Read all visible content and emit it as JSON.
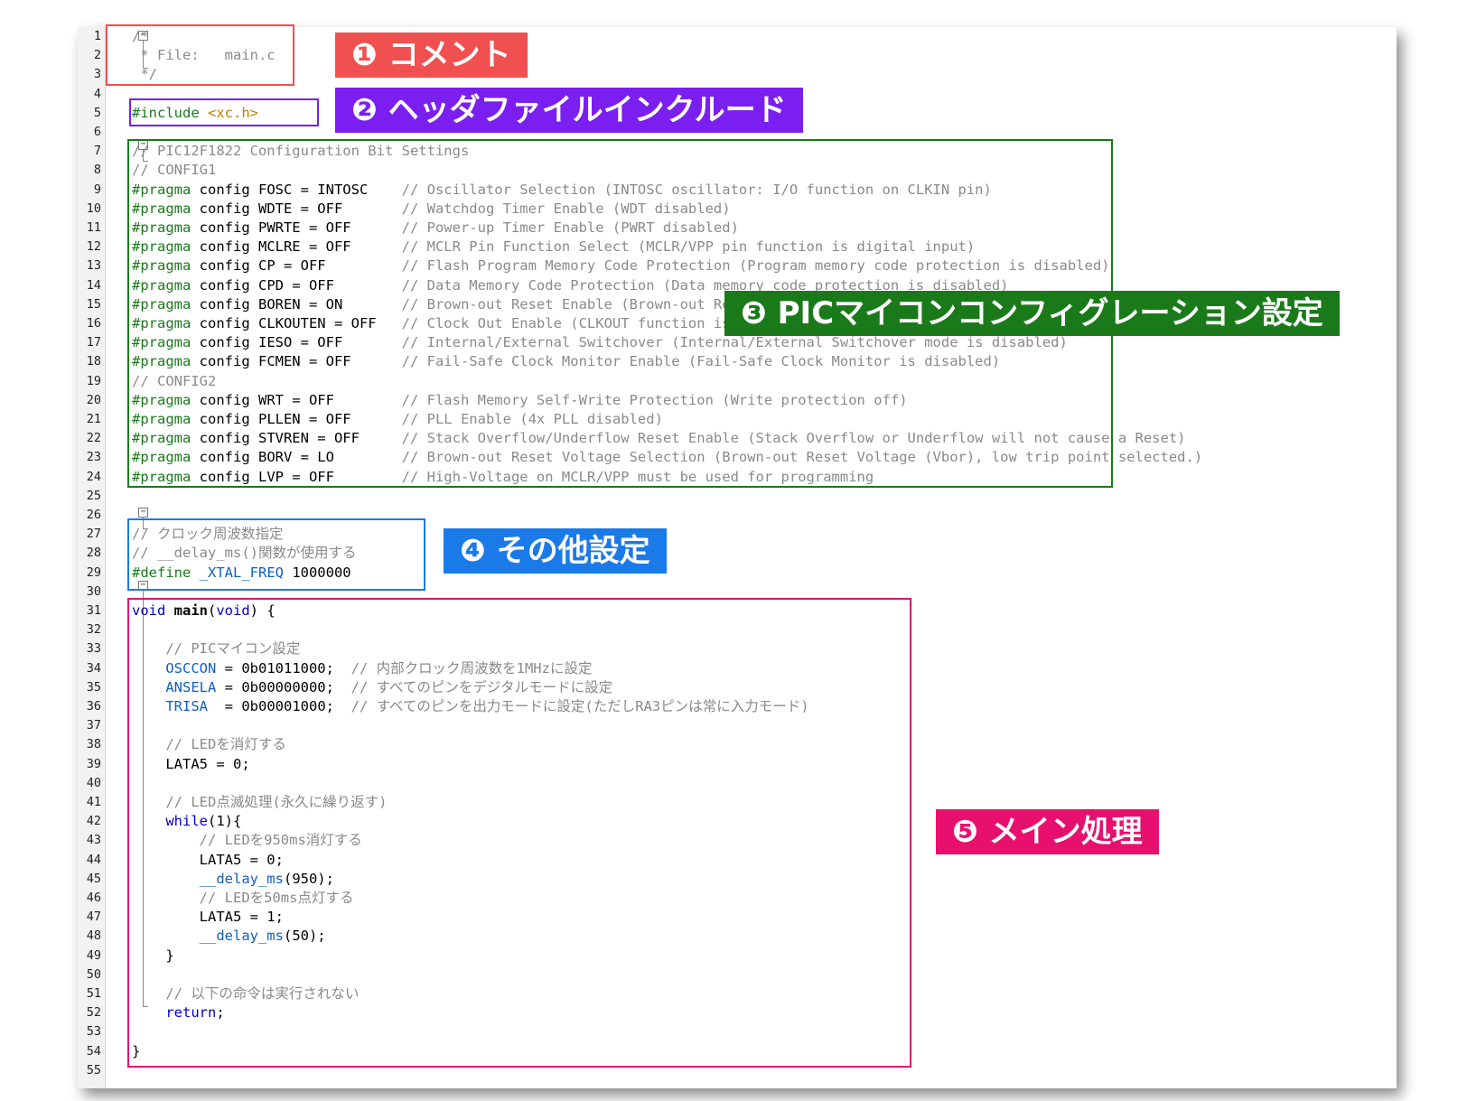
{
  "line_numbers": [
    "1",
    "2",
    "3",
    "4",
    "5",
    "6",
    "7",
    "8",
    "9",
    "10",
    "11",
    "12",
    "13",
    "14",
    "15",
    "16",
    "17",
    "18",
    "19",
    "20",
    "21",
    "22",
    "23",
    "24",
    "25",
    "26",
    "27",
    "28",
    "29",
    "30",
    "31",
    "32",
    "33",
    "34",
    "35",
    "36",
    "37",
    "38",
    "39",
    "40",
    "41",
    "42",
    "43",
    "44",
    "45",
    "46",
    "47",
    "48",
    "49",
    "50",
    "51",
    "52",
    "53",
    "54",
    "55"
  ],
  "code": {
    "l1": "/*",
    "l2": " * File:   main.c",
    "l3": " */",
    "l5_pp": "#include ",
    "l5_str": "<xc.h>",
    "l7": "// PIC12F1822 Configuration Bit Settings",
    "l8": "// CONFIG1",
    "pragma": "#pragma",
    "p9": " config FOSC = INTOSC    ",
    "c9": "// Oscillator Selection (INTOSC oscillator: I/O function on CLKIN pin)",
    "p10": " config WDTE = OFF       ",
    "c10": "// Watchdog Timer Enable (WDT disabled)",
    "p11": " config PWRTE = OFF      ",
    "c11": "// Power-up Timer Enable (PWRT disabled)",
    "p12": " config MCLRE = OFF      ",
    "c12": "// MCLR Pin Function Select (MCLR/VPP pin function is digital input)",
    "p13": " config CP = OFF         ",
    "c13": "// Flash Program Memory Code Protection (Program memory code protection is disabled)",
    "p14": " config CPD = OFF        ",
    "c14": "// Data Memory Code Protection (Data memory code protection is disabled)",
    "p15": " config BOREN = ON       ",
    "c15": "// Brown-out Reset Enable (Brown-out Reset enabled)",
    "p16": " config CLKOUTEN = OFF   ",
    "c16": "// Clock Out Enable (CLKOUT function is disabled)",
    "p17": " config IESO = OFF       ",
    "c17": "// Internal/External Switchover (Internal/External Switchover mode is disabled)",
    "p18": " config FCMEN = OFF      ",
    "c18": "// Fail-Safe Clock Monitor Enable (Fail-Safe Clock Monitor is disabled)",
    "l19": "// CONFIG2",
    "p20": " config WRT = OFF        ",
    "c20": "// Flash Memory Self-Write Protection (Write protection off)",
    "p21": " config PLLEN = OFF      ",
    "c21": "// PLL Enable (4x PLL disabled)",
    "p22": " config STVREN = OFF     ",
    "c22": "// Stack Overflow/Underflow Reset Enable (Stack Overflow or Underflow will not cause a Reset)",
    "p23": " config BORV = LO        ",
    "c23": "// Brown-out Reset Voltage Selection (Brown-out Reset Voltage (Vbor), low trip point selected.)",
    "p24": " config LVP = OFF        ",
    "c24": "// High-Voltage on MCLR/VPP must be used for programming",
    "l27": "// クロック周波数指定",
    "l28": "// __delay_ms()関数が使用する",
    "l29_pp": "#define",
    "l29_name": " _XTAL_FREQ",
    "l29_val": " 1000000",
    "l31_kw1": "void",
    "l31_main": " main",
    "l31_p1": "(",
    "l31_kw2": "void",
    "l31_p2": ") {",
    "l33": "    // PICマイコン設定",
    "l34_reg": "    OSCCON",
    "l34_val": " = 0b01011000;  ",
    "l34_c": "// 内部クロック周波数を1MHzに設定",
    "l35_reg": "    ANSELA",
    "l35_val": " = 0b00000000;  ",
    "l35_c": "// すべてのピンをデジタルモードに設定",
    "l36_reg": "    TRISA",
    "l36_val": "  = 0b00001000;  ",
    "l36_c": "// すべてのピンを出力モードに設定(ただしRA3ピンは常に入力モード)",
    "l38": "    // LEDを消灯する",
    "l39": "    LATA5 = 0;",
    "l41": "    // LED点滅処理(永久に繰り返す)",
    "l42_kw": "    while",
    "l42_rest": "(1){",
    "l43": "        // LEDを950ms消灯する",
    "l44": "        LATA5 = 0;",
    "l45_fn": "        __delay_ms",
    "l45_rest": "(950);",
    "l46": "        // LEDを50ms点灯する",
    "l47": "        LATA5 = 1;",
    "l48_fn": "        __delay_ms",
    "l48_rest": "(50);",
    "l49": "    }",
    "l51": "    // 以下の命令は実行されない",
    "l52_kw": "    return",
    "l52_rest": ";",
    "l54": "}"
  },
  "annotations": {
    "a1": "❶ コメント",
    "a2": "❷ ヘッダファイルインクルード",
    "a3": "❸ PICマイコンコンフィグレーション設定",
    "a4": "❹ その他設定",
    "a5": "❺ メイン処理"
  },
  "colors": {
    "comment_box": "#f05050",
    "include_box": "#7a1ff0",
    "config_box": "#1a7a1a",
    "other_box": "#1a7ae8",
    "main_box": "#e8106e"
  }
}
